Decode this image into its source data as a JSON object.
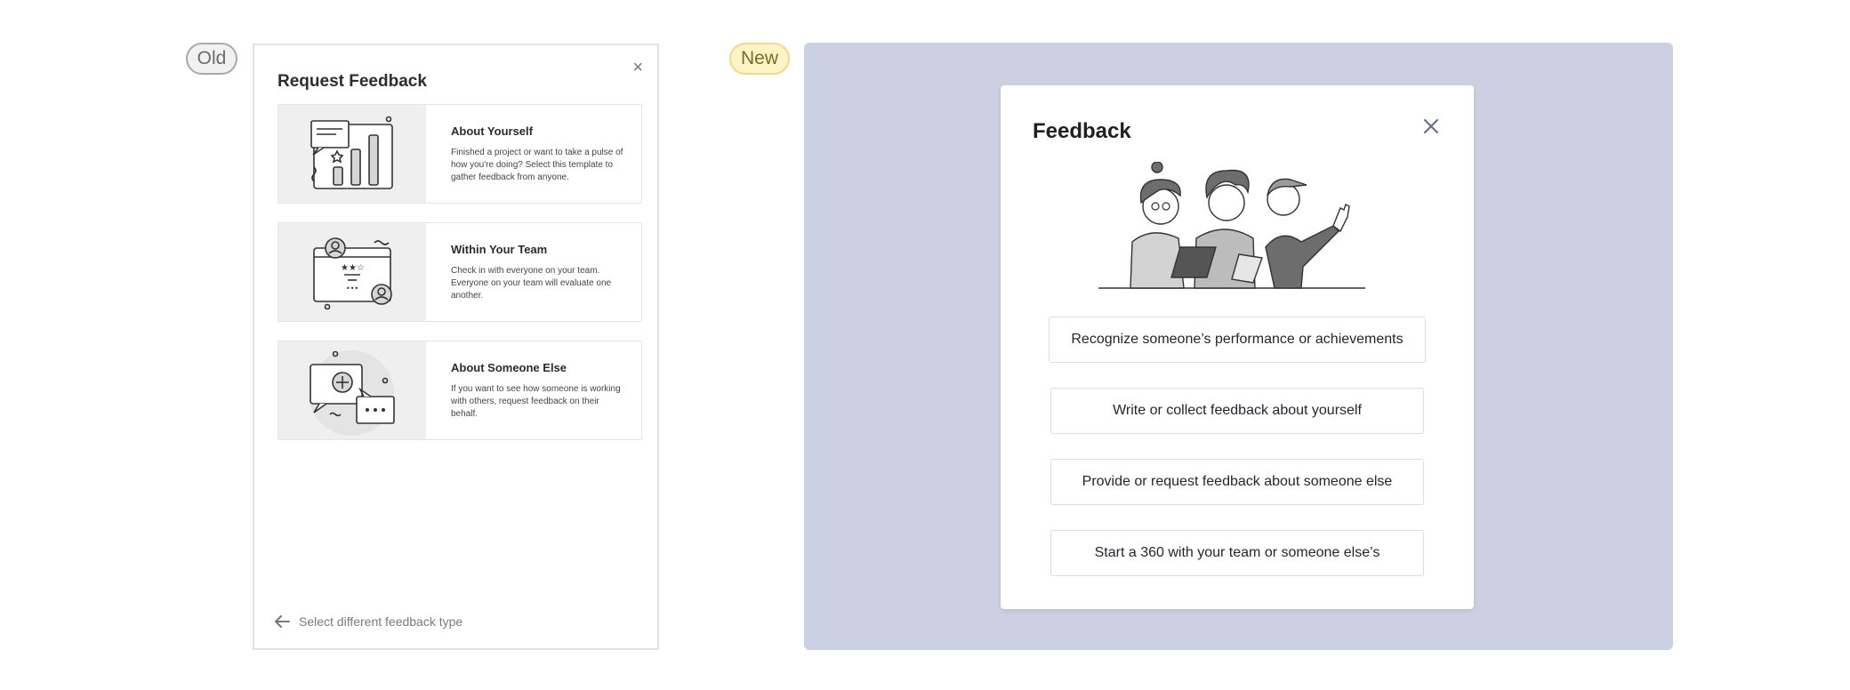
{
  "badges": {
    "old": "Old",
    "new": "New"
  },
  "old": {
    "title": "Request Feedback",
    "close": "×",
    "cards": [
      {
        "title": "About Yourself",
        "desc": "Finished a project or want to take a pulse of how you're doing? Select this template to gather feedback from anyone."
      },
      {
        "title": "Within Your Team",
        "desc": "Check in with everyone on your team. Everyone on your team will evaluate one another."
      },
      {
        "title": "About Someone Else",
        "desc": "If you want to see how someone is working with others, request feedback on their behalf."
      }
    ],
    "back_label": "Select different feedback type"
  },
  "new": {
    "title": "Feedback",
    "options": [
      "Recognize someone’s performance or achievements",
      "Write or collect feedback about yourself",
      "Provide or request feedback about someone else",
      "Start a 360 with your team or someone else’s"
    ]
  },
  "colors": {
    "new_panel_bg": "#cbd0e2",
    "old_badge_bg": "#f1f1f1",
    "new_badge_bg": "#fff4c7"
  }
}
